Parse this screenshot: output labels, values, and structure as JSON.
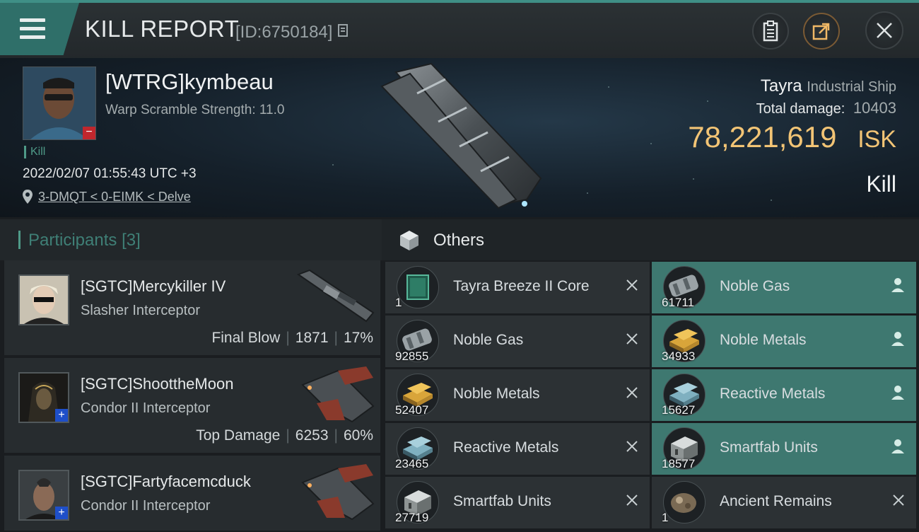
{
  "header": {
    "title": "KILL REPORT",
    "report_id": "[ID:6750184]"
  },
  "victim": {
    "name": "[WTRG]kymbeau",
    "warp_scramble": "Warp Scramble Strength: 11.0",
    "kill_tag": "Kill",
    "timestamp": "2022/02/07 01:55:43 UTC +3",
    "location": "3-DMQT < 0-EIMK < Delve",
    "ship": "Tayra",
    "ship_class": "Industrial Ship",
    "damage_label": "Total damage:",
    "damage_value": "10403",
    "isk_value": "78,221,619",
    "isk_unit": "ISK",
    "result": "Kill"
  },
  "participants": {
    "label": "Participants",
    "count": "[3]",
    "rows": [
      {
        "name": "[SGTC]Mercykiller IV",
        "ship": "Slasher Interceptor",
        "role": "Final Blow",
        "damage": "1871",
        "percent": "17%"
      },
      {
        "name": "[SGTC]ShoottheMoon",
        "ship": "Condor II Interceptor",
        "role": "Top Damage",
        "damage": "6253",
        "percent": "60%"
      },
      {
        "name": "[SGTC]Fartyfacemcduck",
        "ship": "Condor II Interceptor"
      }
    ]
  },
  "others": {
    "label": "Others",
    "items": [
      {
        "qty": "1",
        "name": "Tayra Breeze II Core",
        "status": "destroyed",
        "icon": "ship-core-icon"
      },
      {
        "qty": "61711",
        "name": "Noble Gas",
        "status": "dropped",
        "icon": "gas-canister-icon"
      },
      {
        "qty": "92855",
        "name": "Noble Gas",
        "status": "destroyed",
        "icon": "gas-canister-icon"
      },
      {
        "qty": "34933",
        "name": "Noble Metals",
        "status": "dropped",
        "icon": "gold-ingot-icon"
      },
      {
        "qty": "52407",
        "name": "Noble Metals",
        "status": "destroyed",
        "icon": "gold-ingot-icon"
      },
      {
        "qty": "15627",
        "name": "Reactive Metals",
        "status": "dropped",
        "icon": "blue-ingot-icon"
      },
      {
        "qty": "23465",
        "name": "Reactive Metals",
        "status": "destroyed",
        "icon": "blue-ingot-icon"
      },
      {
        "qty": "18577",
        "name": "Smartfab Units",
        "status": "dropped",
        "icon": "smartfab-icon"
      },
      {
        "qty": "27719",
        "name": "Smartfab Units",
        "status": "destroyed",
        "icon": "smartfab-icon"
      },
      {
        "qty": "1",
        "name": "Ancient Remains",
        "status": "destroyed",
        "icon": "remains-icon"
      }
    ]
  },
  "colors": {
    "accent": "#3f8f86",
    "isk": "#f2c475",
    "dropped_bg": "#3e7870"
  }
}
